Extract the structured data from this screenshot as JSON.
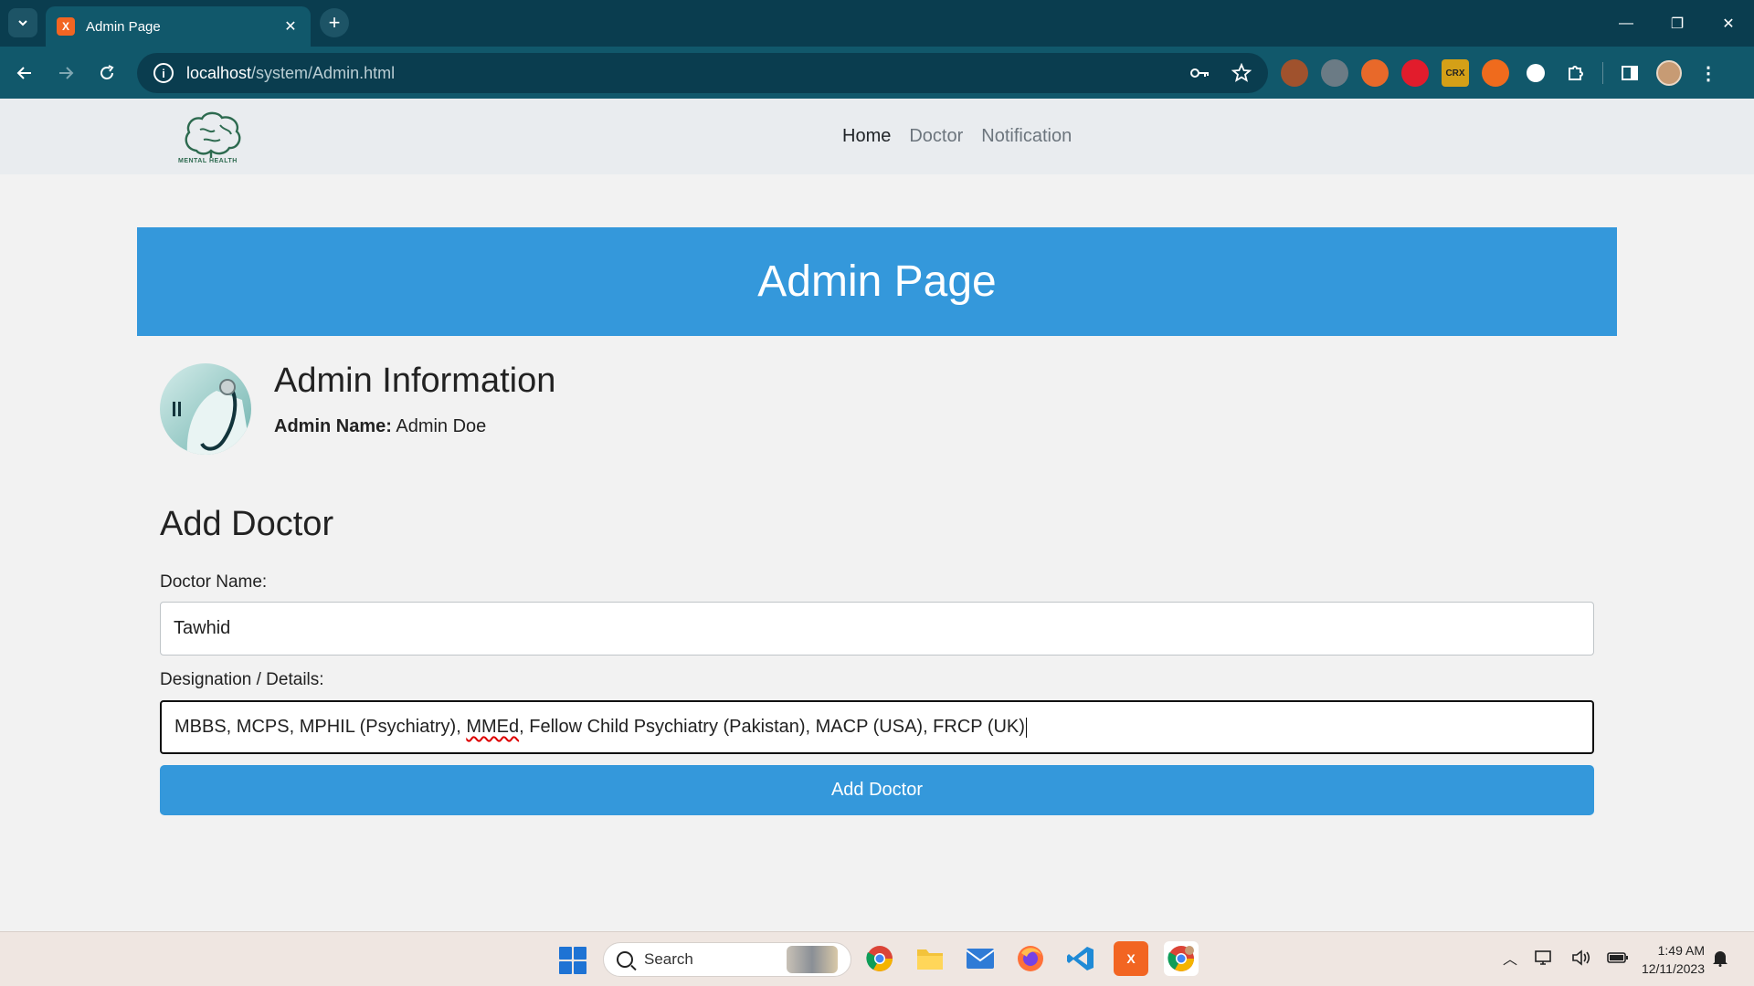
{
  "browser": {
    "tab_title": "Admin Page",
    "tab_favicon_text": "X",
    "url_host": "localhost",
    "url_path": "/system/Admin.html",
    "icons": {
      "tab_list": "chevron-down-icon",
      "close": "close-icon",
      "new_tab": "plus-icon",
      "back": "arrow-left-icon",
      "forward": "arrow-right-icon",
      "reload": "reload-icon",
      "info": "info-icon",
      "key": "key-icon",
      "bookmark": "star-icon"
    },
    "extensions": [
      {
        "name": "cookie-extension-icon",
        "color": "#a0522d",
        "text": ""
      },
      {
        "name": "raccoon-extension-icon",
        "color": "#6b7b85",
        "text": ""
      },
      {
        "name": "fire-extension-icon",
        "color": "#e8692a",
        "text": ""
      },
      {
        "name": "hand-extension-icon",
        "color": "#e21c2c",
        "text": ""
      },
      {
        "name": "crx-extension-icon",
        "color": "#d4a017",
        "text": "CRX"
      },
      {
        "name": "leaf-extension-icon",
        "color": "#ef6b1d",
        "text": ""
      },
      {
        "name": "circle-extension-icon",
        "color": "#ffffff",
        "text": ""
      },
      {
        "name": "puzzle-extensions-icon",
        "color": "#11586b",
        "text": ""
      }
    ]
  },
  "site_nav": {
    "logo_text": "MENTAL HEALTH",
    "links": [
      {
        "label": "Home",
        "active": true
      },
      {
        "label": "Doctor",
        "active": false
      },
      {
        "label": "Notification",
        "active": false
      }
    ]
  },
  "banner": {
    "title": "Admin Page"
  },
  "admin": {
    "section_title": "Admin Information",
    "name_label": "Admin Name:",
    "name_value": "Admin Doe"
  },
  "add_doctor": {
    "title": "Add Doctor",
    "name_label": "Doctor Name:",
    "name_value": "Tawhid",
    "details_label": "Designation / Details:",
    "details_before": "MBBS, MCPS, MPHIL (Psychiatry), ",
    "details_misspelled": "MMEd",
    "details_after": ", Fellow Child Psychiatry (Pakistan), MACP (USA), FRCP (UK)",
    "submit_label": "Add Doctor"
  },
  "taskbar": {
    "search_placeholder": "Search",
    "apps": [
      {
        "name": "chrome-taskbar-icon",
        "color": "#ffffff",
        "text": ""
      },
      {
        "name": "file-explorer-icon",
        "color": "#f3c33b",
        "text": ""
      },
      {
        "name": "mail-icon",
        "color": "#2f7bd6",
        "text": ""
      },
      {
        "name": "firefox-icon",
        "color": "#ff7139",
        "text": ""
      },
      {
        "name": "vscode-icon",
        "color": "#1f8ad6",
        "text": ""
      },
      {
        "name": "xampp-icon",
        "color": "#f26522",
        "text": "X"
      },
      {
        "name": "chrome-active-icon",
        "color": "#ffffff",
        "text": ""
      }
    ],
    "time": "1:49 AM",
    "date": "12/11/2023"
  },
  "colors": {
    "primary": "#3498db",
    "chrome_dark": "#0a3d4f",
    "chrome_mid": "#11586b"
  }
}
